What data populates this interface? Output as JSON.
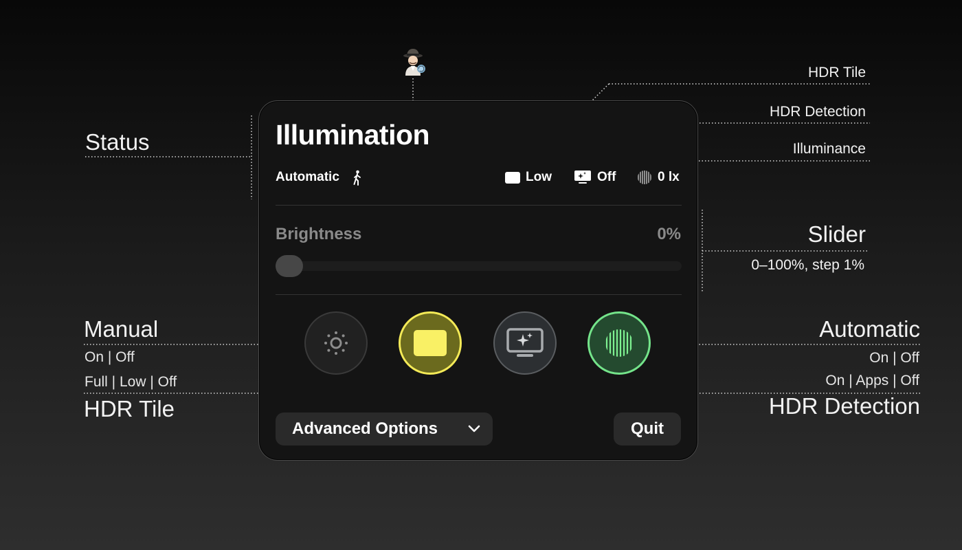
{
  "annotations": {
    "status": "Status",
    "hdr_tile_top": "HDR Tile",
    "hdr_detection_top": "HDR Detection",
    "illuminance": "Illuminance",
    "slider": "Slider",
    "slider_desc": "0–100%, step 1%",
    "manual": "Manual",
    "manual_desc": "On | Off",
    "hdr_tile_desc": "Full | Low | Off",
    "hdr_tile_bottom": "HDR Tile",
    "automatic": "Automatic",
    "automatic_desc": "On | Off",
    "detection_desc": "On | Apps | Off",
    "hdr_detection_bottom": "HDR Detection"
  },
  "panel": {
    "title": "Illumination",
    "status": {
      "mode": "Automatic",
      "mode_icon": "walking-person-icon",
      "hdr_tile": "Low",
      "hdr_tile_icon": "tile-icon",
      "hdr_detection": "Off",
      "hdr_detection_icon": "monitor-sparkle-icon",
      "illuminance": "0 lx",
      "illuminance_icon": "light-sensor-icon"
    },
    "brightness": {
      "label": "Brightness",
      "value_text": "0%",
      "value": 0
    },
    "buttons": [
      {
        "name": "manual",
        "icon": "sun-icon",
        "color": "#212121"
      },
      {
        "name": "hdr-tile",
        "icon": "tile-icon",
        "color": "#f4ea57"
      },
      {
        "name": "hdr-detection",
        "icon": "monitor-sparkle-icon",
        "color": "#5a5d60"
      },
      {
        "name": "automatic",
        "icon": "light-sensor-icon",
        "color": "#74e48a"
      }
    ],
    "advanced_label": "Advanced Options",
    "quit_label": "Quit"
  },
  "mascot_icon": "detective-icon"
}
